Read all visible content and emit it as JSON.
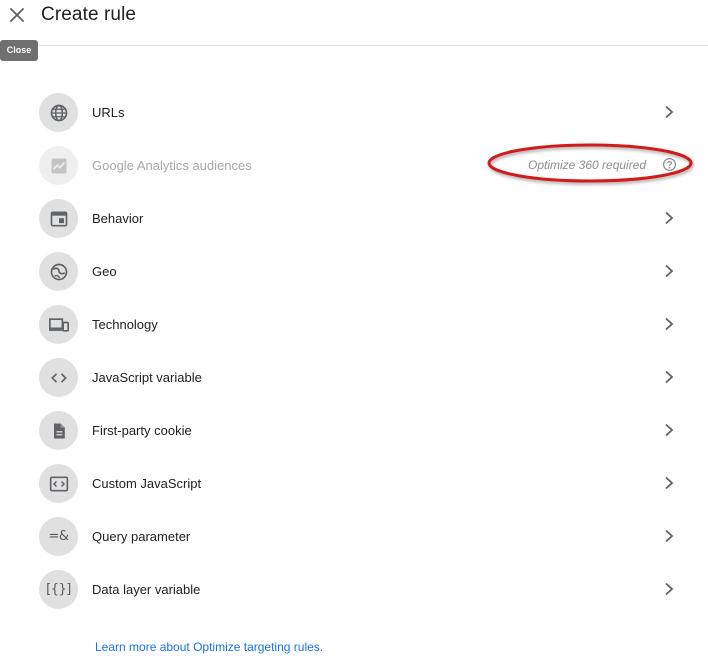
{
  "header": {
    "title": "Create rule",
    "close_tooltip": "Close"
  },
  "rules": [
    {
      "label": "URLs",
      "icon": "globe-icon",
      "enabled": true
    },
    {
      "label": "Google Analytics audiences",
      "icon": "analytics-chart-icon",
      "enabled": false,
      "note": "Optimize 360 required"
    },
    {
      "label": "Behavior",
      "icon": "browser-window-icon",
      "enabled": true
    },
    {
      "label": "Geo",
      "icon": "earth-icon",
      "enabled": true
    },
    {
      "label": "Technology",
      "icon": "devices-icon",
      "enabled": true
    },
    {
      "label": "JavaScript variable",
      "icon": "code-brackets-icon",
      "enabled": true
    },
    {
      "label": "First-party cookie",
      "icon": "document-icon",
      "enabled": true
    },
    {
      "label": "Custom JavaScript",
      "icon": "custom-code-icon",
      "enabled": true
    },
    {
      "label": "Query parameter",
      "icon": "query-parameter-icon",
      "icon_text": "=&",
      "enabled": true
    },
    {
      "label": "Data layer variable",
      "icon": "data-layer-icon",
      "icon_text": "[{}]",
      "enabled": true
    }
  ],
  "footer": {
    "learn_more_link": "Learn more about Optimize targeting rules."
  },
  "colors": {
    "accent_link": "#1a73e8",
    "icon_circle": "#e0e0e0",
    "highlight_ellipse": "#d11a1a"
  }
}
